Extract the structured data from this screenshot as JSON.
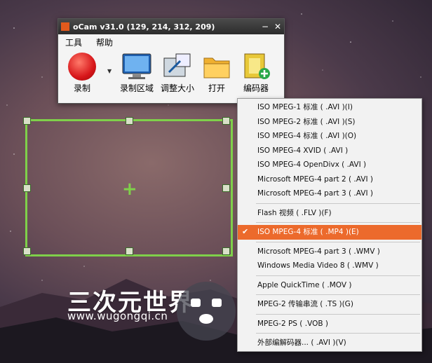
{
  "window": {
    "title": "oCam v31.0 (129, 214, 312, 209)",
    "minimize": "−",
    "close": "✕"
  },
  "menubar": {
    "tools": "工具",
    "help": "帮助"
  },
  "toolbar": {
    "record": "录制",
    "record_area": "录制区域",
    "resize": "调整大小",
    "open": "打开",
    "codec": "编码器"
  },
  "codec_menu": {
    "items": [
      {
        "label": "ISO MPEG-1 标准 ( .AVI )(I)"
      },
      {
        "label": "ISO MPEG-2 标准 ( .AVI )(S)"
      },
      {
        "label": "ISO MPEG-4 标准 ( .AVI )(O)"
      },
      {
        "label": "ISO MPEG-4 XVID ( .AVI )"
      },
      {
        "label": "ISO MPEG-4 OpenDivx ( .AVI )"
      },
      {
        "label": "Microsoft MPEG-4 part 2 ( .AVI )"
      },
      {
        "label": "Microsoft MPEG-4 part 3 ( .AVI )"
      },
      {
        "label": "Flash 视频 ( .FLV )(F)"
      },
      {
        "label": "ISO MPEG-4 标准 ( .MP4 )(E)",
        "selected": true
      },
      {
        "label": "Microsoft MPEG-4 part 3 ( .WMV )"
      },
      {
        "label": "Windows Media Video 8 ( .WMV )"
      },
      {
        "label": "Apple QuickTime ( .MOV )"
      },
      {
        "label": "MPEG-2 传输串流 ( .TS )(G)"
      },
      {
        "label": "MPEG-2 PS ( .VOB )"
      },
      {
        "label": "外部编解码器... ( .AVI )(V)"
      }
    ],
    "check": "✔"
  },
  "watermark": {
    "name": "三次元世界",
    "url": "www.wugongqi.cn"
  },
  "colors": {
    "selection_border": "#7fd04a",
    "menu_highlight": "#ec6a2c"
  }
}
